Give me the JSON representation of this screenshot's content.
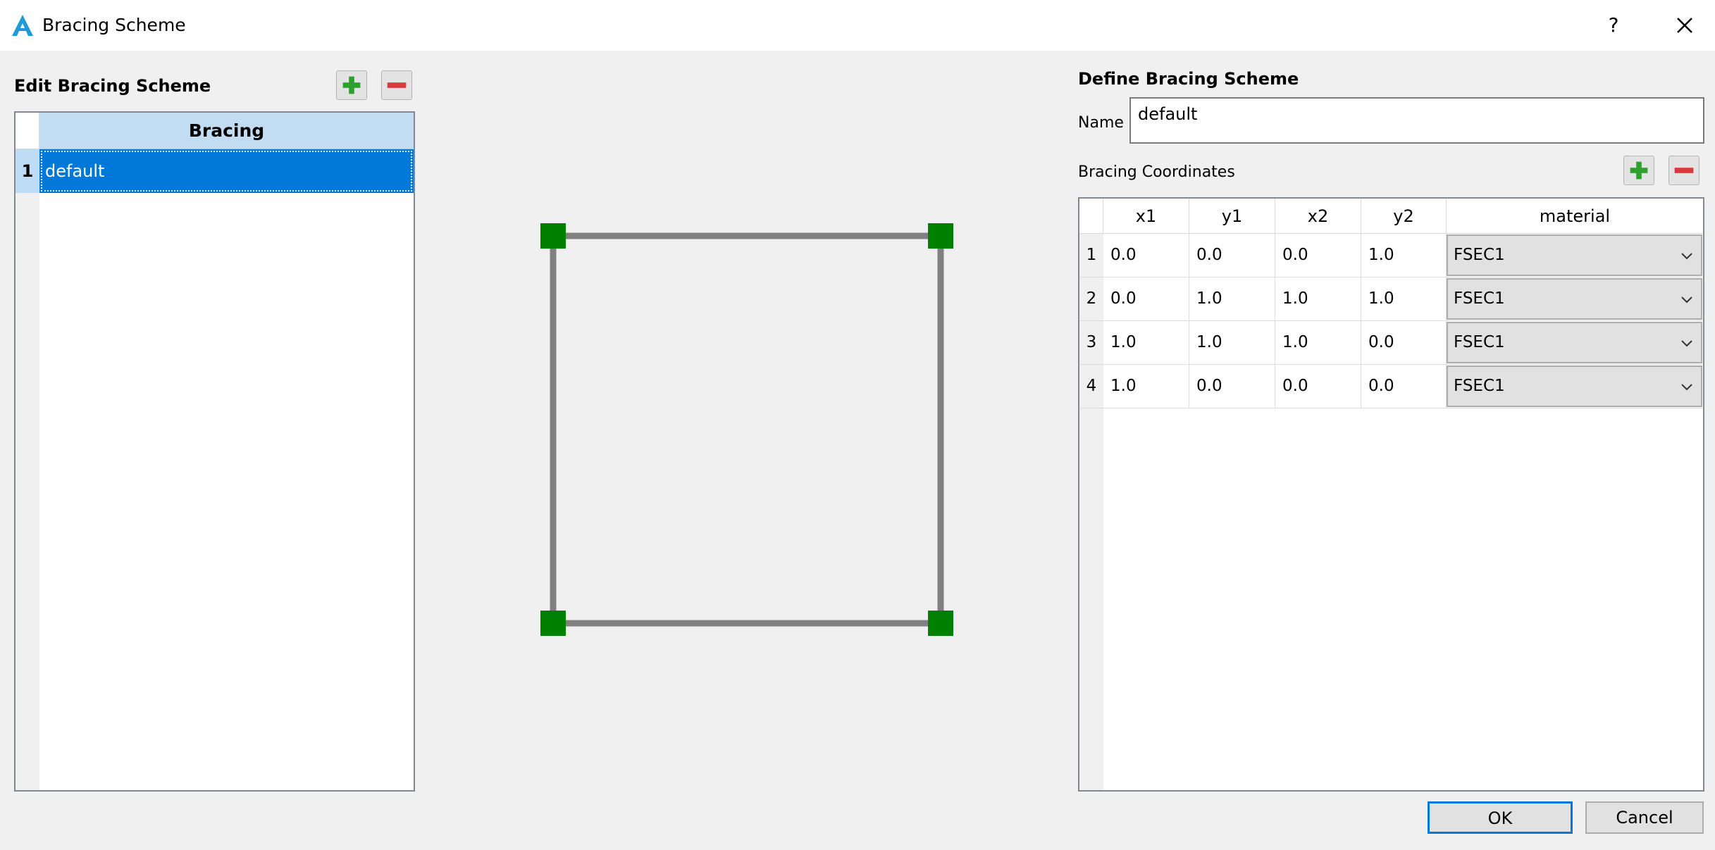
{
  "window": {
    "title": "Bracing Scheme",
    "help_label": "?",
    "icons": {
      "app": "app-logo-icon",
      "close": "close-icon"
    }
  },
  "left_panel": {
    "title": "Edit Bracing Scheme",
    "column_header": "Bracing",
    "rows": [
      {
        "number": "1",
        "name": "default",
        "selected": true
      }
    ]
  },
  "right_panel": {
    "title": "Define Bracing Scheme",
    "name_label": "Name",
    "name_value": "default",
    "coords_label": "Bracing Coordinates",
    "columns": [
      "x1",
      "y1",
      "x2",
      "y2",
      "material"
    ],
    "rows": [
      {
        "number": "1",
        "x1": "0.0",
        "y1": "0.0",
        "x2": "0.0",
        "y2": "1.0",
        "material": "FSEC1"
      },
      {
        "number": "2",
        "x1": "0.0",
        "y1": "1.0",
        "x2": "1.0",
        "y2": "1.0",
        "material": "FSEC1"
      },
      {
        "number": "3",
        "x1": "1.0",
        "y1": "1.0",
        "x2": "1.0",
        "y2": "0.0",
        "material": "FSEC1"
      },
      {
        "number": "4",
        "x1": "1.0",
        "y1": "0.0",
        "x2": "0.0",
        "y2": "0.0",
        "material": "FSEC1"
      }
    ]
  },
  "buttons": {
    "ok": "OK",
    "cancel": "Cancel"
  },
  "colors": {
    "accent": "#0078d7",
    "node": "#008000",
    "member": "#808080",
    "add": "#2ea02e",
    "remove": "#d63a3a"
  }
}
